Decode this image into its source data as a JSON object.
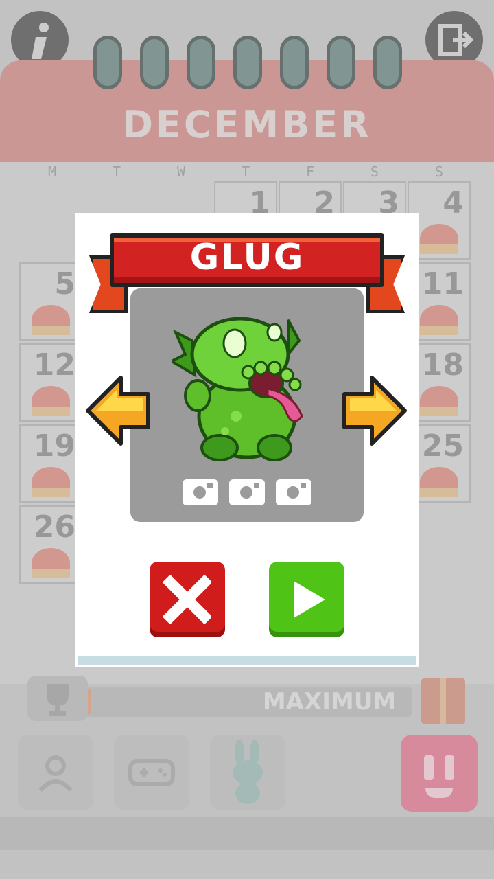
{
  "calendar": {
    "month": "DECEMBER",
    "weekdays": [
      "M",
      "T",
      "W",
      "T",
      "F",
      "S",
      "S"
    ],
    "days": [
      "1",
      "2",
      "3",
      "4",
      "5",
      "11",
      "12",
      "18",
      "19",
      "25",
      "26"
    ]
  },
  "progress": {
    "label": "MAXIMUM",
    "fill_fraction": 0.02
  },
  "dialog": {
    "character_name": "GLUG",
    "photo_slots": 3
  },
  "colors": {
    "banner": "#d32222",
    "cancel": "#d11c1c",
    "play": "#4fc417",
    "portrait_bg": "#9b9b9b",
    "monster": "#5fbf2a"
  },
  "icons": {
    "info": "info-icon",
    "exit": "exit-icon",
    "cancel": "close-icon",
    "play": "play-icon",
    "prev": "arrow-left-icon",
    "next": "arrow-right-icon"
  }
}
